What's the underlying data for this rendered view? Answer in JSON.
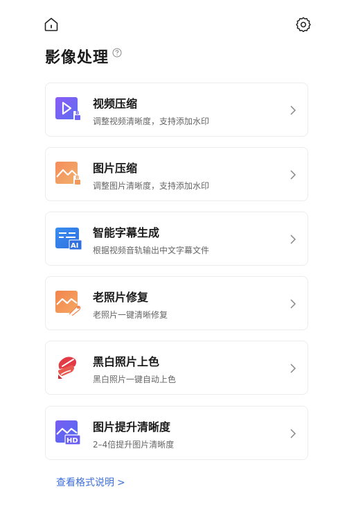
{
  "page": {
    "title": "影像处理",
    "help_icon": "help-circle-icon"
  },
  "topbar": {
    "home_icon": "home-icon",
    "settings_icon": "gear-icon"
  },
  "cards": [
    {
      "title": "视频压缩",
      "desc": "调整视频清晰度，支持添加水印",
      "icon": "video-compress-icon"
    },
    {
      "title": "图片压缩",
      "desc": "调整图片清晰度，支持添加水印",
      "icon": "image-compress-icon"
    },
    {
      "title": "智能字幕生成",
      "desc": "根据视频音轨输出中文字幕文件",
      "icon": "ai-subtitle-icon"
    },
    {
      "title": "老照片修复",
      "desc": "老照片一键清晰修复",
      "icon": "photo-repair-icon"
    },
    {
      "title": "黑白照片上色",
      "desc": "黑白照片一键自动上色",
      "icon": "colorize-icon"
    },
    {
      "title": "图片提升清晰度",
      "desc": "2–4倍提升图片清晰度",
      "icon": "hd-enhance-icon"
    }
  ],
  "footer": {
    "link_label": "查看格式说明",
    "link_arrow": ">"
  },
  "colors": {
    "accent_blue": "#3d6fd8",
    "purple": "#7b5cf0",
    "orange": "#f0935a",
    "red": "#e2424a"
  }
}
